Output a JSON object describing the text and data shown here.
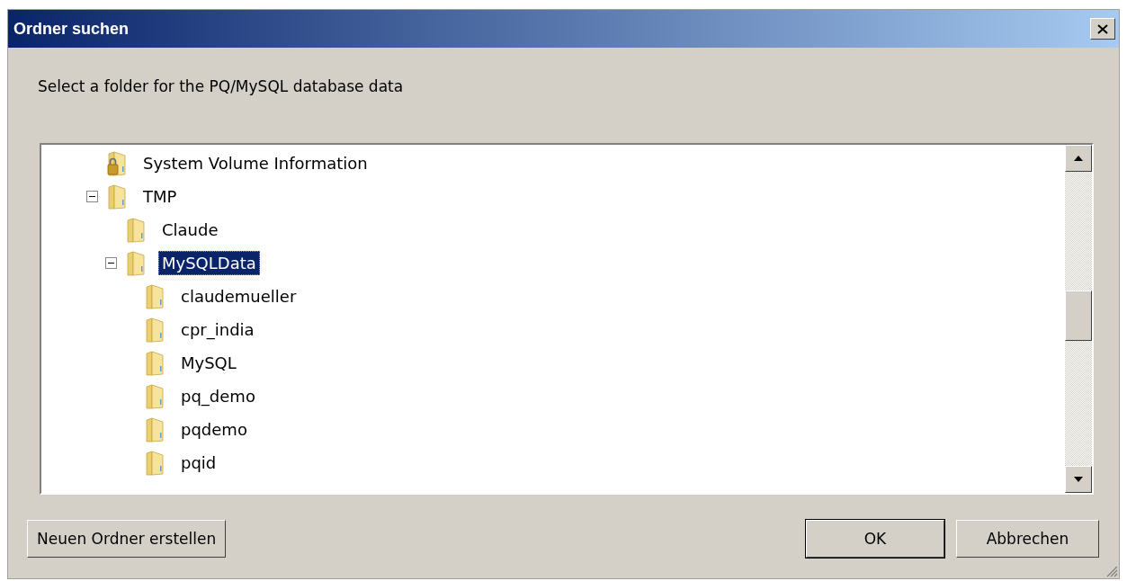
{
  "window": {
    "title": "Ordner suchen"
  },
  "prompt": "Select a folder for the PQ/MySQL database data",
  "tree": [
    {
      "label": "System Volume Information",
      "kind": "locked",
      "selected": false
    },
    {
      "label": "TMP",
      "kind": "folder",
      "selected": false,
      "expanded": true,
      "children": [
        {
          "label": "Claude",
          "kind": "folder",
          "selected": false
        },
        {
          "label": "MySQLData",
          "kind": "folder",
          "selected": true,
          "expanded": true,
          "children": [
            {
              "label": "claudemueller",
              "kind": "folder",
              "selected": false
            },
            {
              "label": "cpr_india",
              "kind": "folder",
              "selected": false
            },
            {
              "label": "MySQL",
              "kind": "folder",
              "selected": false
            },
            {
              "label": "pq_demo",
              "kind": "folder",
              "selected": false
            },
            {
              "label": "pqdemo",
              "kind": "folder",
              "selected": false
            },
            {
              "label": "pqid",
              "kind": "folder",
              "selected": false
            }
          ]
        }
      ]
    }
  ],
  "buttons": [
    {
      "label": "Neuen Ordner erstellen",
      "kind": "new-folder"
    },
    {
      "label": "OK",
      "kind": "default"
    },
    {
      "label": "Abbrechen",
      "kind": "cancel"
    }
  ]
}
